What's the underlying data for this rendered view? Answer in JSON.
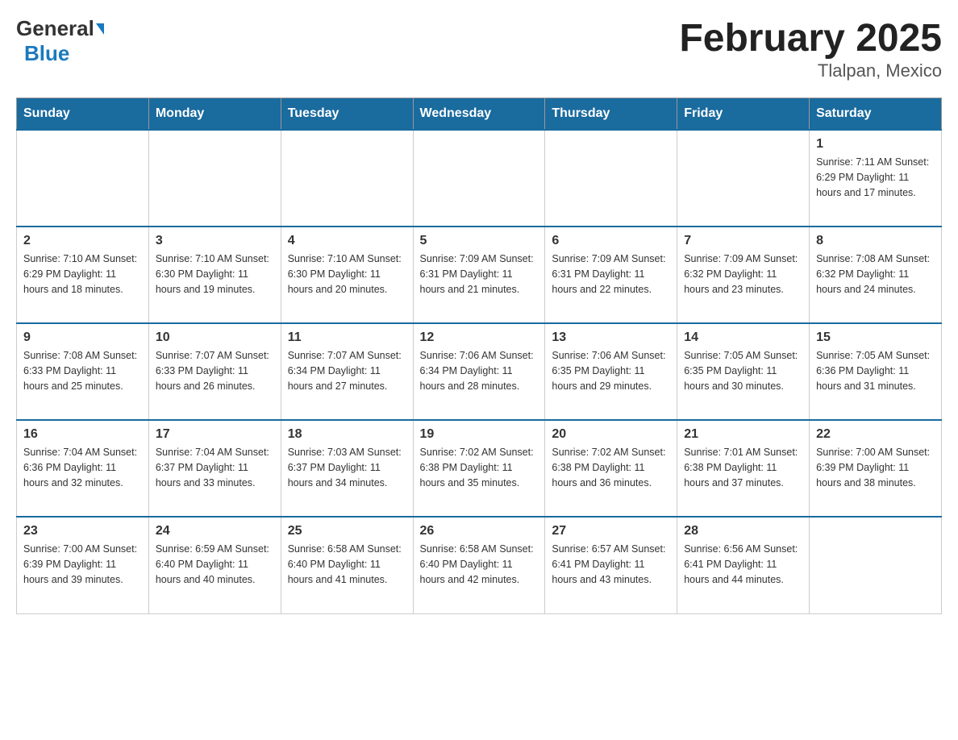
{
  "header": {
    "logo_general": "General",
    "logo_blue": "Blue",
    "title": "February 2025",
    "subtitle": "Tlalpan, Mexico"
  },
  "days_of_week": [
    "Sunday",
    "Monday",
    "Tuesday",
    "Wednesday",
    "Thursday",
    "Friday",
    "Saturday"
  ],
  "weeks": [
    [
      {
        "day": "",
        "info": ""
      },
      {
        "day": "",
        "info": ""
      },
      {
        "day": "",
        "info": ""
      },
      {
        "day": "",
        "info": ""
      },
      {
        "day": "",
        "info": ""
      },
      {
        "day": "",
        "info": ""
      },
      {
        "day": "1",
        "info": "Sunrise: 7:11 AM\nSunset: 6:29 PM\nDaylight: 11 hours and 17 minutes."
      }
    ],
    [
      {
        "day": "2",
        "info": "Sunrise: 7:10 AM\nSunset: 6:29 PM\nDaylight: 11 hours and 18 minutes."
      },
      {
        "day": "3",
        "info": "Sunrise: 7:10 AM\nSunset: 6:30 PM\nDaylight: 11 hours and 19 minutes."
      },
      {
        "day": "4",
        "info": "Sunrise: 7:10 AM\nSunset: 6:30 PM\nDaylight: 11 hours and 20 minutes."
      },
      {
        "day": "5",
        "info": "Sunrise: 7:09 AM\nSunset: 6:31 PM\nDaylight: 11 hours and 21 minutes."
      },
      {
        "day": "6",
        "info": "Sunrise: 7:09 AM\nSunset: 6:31 PM\nDaylight: 11 hours and 22 minutes."
      },
      {
        "day": "7",
        "info": "Sunrise: 7:09 AM\nSunset: 6:32 PM\nDaylight: 11 hours and 23 minutes."
      },
      {
        "day": "8",
        "info": "Sunrise: 7:08 AM\nSunset: 6:32 PM\nDaylight: 11 hours and 24 minutes."
      }
    ],
    [
      {
        "day": "9",
        "info": "Sunrise: 7:08 AM\nSunset: 6:33 PM\nDaylight: 11 hours and 25 minutes."
      },
      {
        "day": "10",
        "info": "Sunrise: 7:07 AM\nSunset: 6:33 PM\nDaylight: 11 hours and 26 minutes."
      },
      {
        "day": "11",
        "info": "Sunrise: 7:07 AM\nSunset: 6:34 PM\nDaylight: 11 hours and 27 minutes."
      },
      {
        "day": "12",
        "info": "Sunrise: 7:06 AM\nSunset: 6:34 PM\nDaylight: 11 hours and 28 minutes."
      },
      {
        "day": "13",
        "info": "Sunrise: 7:06 AM\nSunset: 6:35 PM\nDaylight: 11 hours and 29 minutes."
      },
      {
        "day": "14",
        "info": "Sunrise: 7:05 AM\nSunset: 6:35 PM\nDaylight: 11 hours and 30 minutes."
      },
      {
        "day": "15",
        "info": "Sunrise: 7:05 AM\nSunset: 6:36 PM\nDaylight: 11 hours and 31 minutes."
      }
    ],
    [
      {
        "day": "16",
        "info": "Sunrise: 7:04 AM\nSunset: 6:36 PM\nDaylight: 11 hours and 32 minutes."
      },
      {
        "day": "17",
        "info": "Sunrise: 7:04 AM\nSunset: 6:37 PM\nDaylight: 11 hours and 33 minutes."
      },
      {
        "day": "18",
        "info": "Sunrise: 7:03 AM\nSunset: 6:37 PM\nDaylight: 11 hours and 34 minutes."
      },
      {
        "day": "19",
        "info": "Sunrise: 7:02 AM\nSunset: 6:38 PM\nDaylight: 11 hours and 35 minutes."
      },
      {
        "day": "20",
        "info": "Sunrise: 7:02 AM\nSunset: 6:38 PM\nDaylight: 11 hours and 36 minutes."
      },
      {
        "day": "21",
        "info": "Sunrise: 7:01 AM\nSunset: 6:38 PM\nDaylight: 11 hours and 37 minutes."
      },
      {
        "day": "22",
        "info": "Sunrise: 7:00 AM\nSunset: 6:39 PM\nDaylight: 11 hours and 38 minutes."
      }
    ],
    [
      {
        "day": "23",
        "info": "Sunrise: 7:00 AM\nSunset: 6:39 PM\nDaylight: 11 hours and 39 minutes."
      },
      {
        "day": "24",
        "info": "Sunrise: 6:59 AM\nSunset: 6:40 PM\nDaylight: 11 hours and 40 minutes."
      },
      {
        "day": "25",
        "info": "Sunrise: 6:58 AM\nSunset: 6:40 PM\nDaylight: 11 hours and 41 minutes."
      },
      {
        "day": "26",
        "info": "Sunrise: 6:58 AM\nSunset: 6:40 PM\nDaylight: 11 hours and 42 minutes."
      },
      {
        "day": "27",
        "info": "Sunrise: 6:57 AM\nSunset: 6:41 PM\nDaylight: 11 hours and 43 minutes."
      },
      {
        "day": "28",
        "info": "Sunrise: 6:56 AM\nSunset: 6:41 PM\nDaylight: 11 hours and 44 minutes."
      },
      {
        "day": "",
        "info": ""
      }
    ]
  ]
}
